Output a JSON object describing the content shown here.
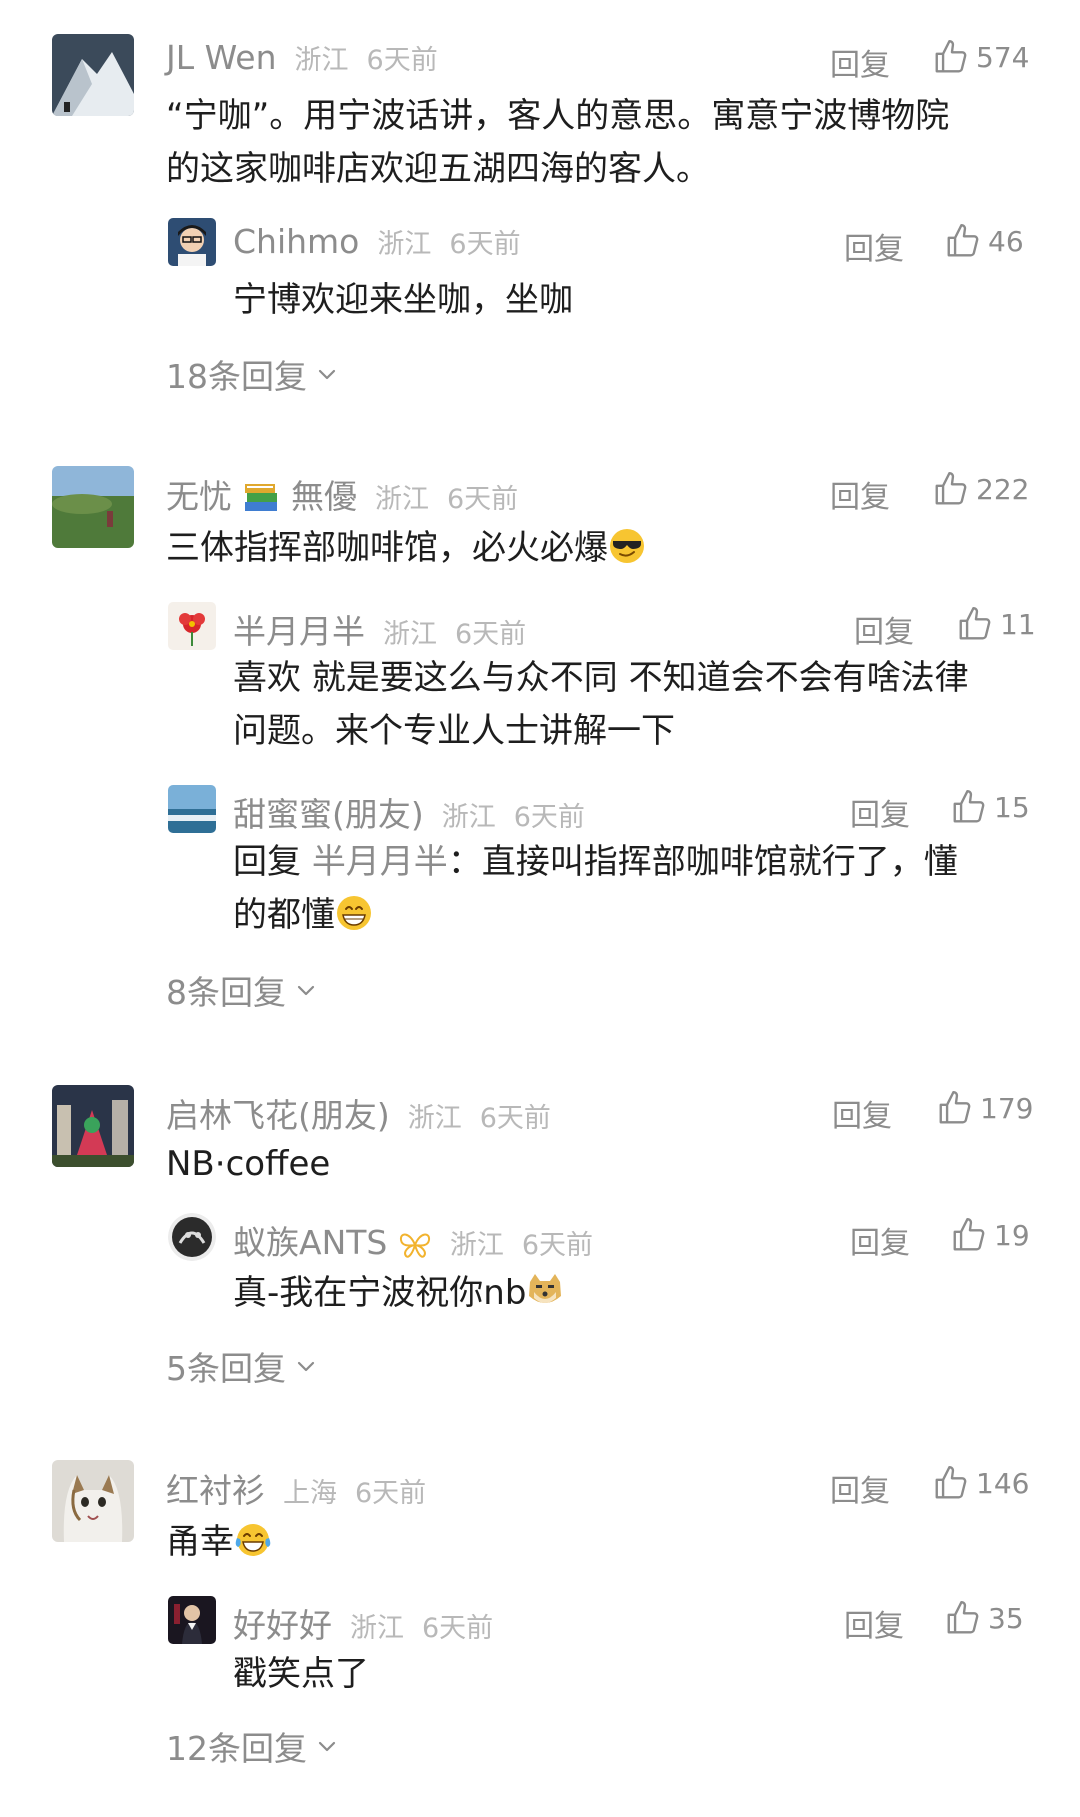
{
  "reply_label": "回复",
  "comments": [
    {
      "name": "JL Wen",
      "region": "浙江",
      "time": "6天前",
      "likes": "574",
      "text_line1": "“宁咖”。用宁波话讲，客人的意思。寓意宁波博物院",
      "text_line2": "的这家咖啡店欢迎五湖四海的客人。",
      "replies": [
        {
          "name": "Chihmo",
          "region": "浙江",
          "time": "6天前",
          "likes": "46",
          "text": "宁博欢迎来坐咖，坐咖"
        }
      ],
      "more": "18条回复"
    },
    {
      "name": "无忧",
      "name_suffix": "無優",
      "region": "浙江",
      "time": "6天前",
      "likes": "222",
      "text": "三体指挥部咖啡馆，必火必爆",
      "replies": [
        {
          "name": "半月月半",
          "region": "浙江",
          "time": "6天前",
          "likes": "11",
          "text_line1": "喜欢 就是要这么与众不同 不知道会不会有啥法律",
          "text_line2": "问题。来个专业人士讲解一下"
        },
        {
          "name": "甜蜜蜜(朋友)",
          "region": "浙江",
          "time": "6天前",
          "likes": "15",
          "reply_prefix": "回复",
          "reply_to": "半月月半",
          "text_line1": "：直接叫指挥部咖啡馆就行了，懂",
          "text_line2": "的都懂"
        }
      ],
      "more": "8条回复"
    },
    {
      "name": "启林飞花(朋友)",
      "region": "浙江",
      "time": "6天前",
      "likes": "179",
      "text": "NB·coffee",
      "replies": [
        {
          "name": "蚁族ANTS",
          "region": "浙江",
          "time": "6天前",
          "likes": "19",
          "text": "真-我在宁波祝你nb"
        }
      ],
      "more": "5条回复"
    },
    {
      "name": "红衬衫",
      "region": "上海",
      "time": "6天前",
      "likes": "146",
      "text": "甬幸",
      "replies": [
        {
          "name": "好好好",
          "region": "浙江",
          "time": "6天前",
          "likes": "35",
          "text": "戳笑点了"
        }
      ],
      "more": "12条回复"
    }
  ]
}
